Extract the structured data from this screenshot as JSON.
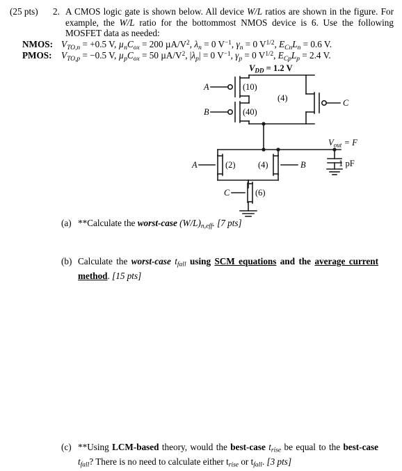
{
  "header": {
    "points": "(25 pts)",
    "number": "2.",
    "line1_a": "A CMOS logic gate is shown below.  All device ",
    "line1_wl": "W/L",
    "line1_b": " ratios are shown in the figure.  For example, the ",
    "line1_wl2": "W/L",
    "line1_c": " ratio for the bottommost NMOS device is 6.  Use the following MOSFET data as needed:"
  },
  "device_data": {
    "nmos_label": "NMOS:",
    "nmos_vto_sym": "V",
    "nmos_vto_sub": "TO,n",
    "nmos_vto_val": "= +0.5 V,",
    "nmos_mu_sym": "µ",
    "nmos_mu_sub": "n",
    "nmos_cox_sym": "C",
    "nmos_cox_sub": "ox",
    "nmos_mu_val": "= 200 µA/V",
    "nmos_mu_exp": "2",
    "nmos_lambda_sym": "λ",
    "nmos_lambda_sub": "n",
    "nmos_lambda_val": "= 0 V",
    "nmos_lambda_exp": "−1",
    "nmos_gamma_sym": "γ",
    "nmos_gamma_sub": "n",
    "nmos_gamma_val": "= 0 V",
    "nmos_gamma_exp": "1/2",
    "nmos_ec_sym": "E",
    "nmos_ec_sub": "Cn",
    "nmos_l_sym": "L",
    "nmos_l_sub": "n",
    "nmos_ec_val": "= 0.6 V.",
    "pmos_label": "PMOS:",
    "pmos_vto_sym": "V",
    "pmos_vto_sub": "TO,p",
    "pmos_vto_val": "= −0.5 V,",
    "pmos_mu_sym": "µ",
    "pmos_mu_sub": "p",
    "pmos_cox_sym": "C",
    "pmos_cox_sub": "ox",
    "pmos_mu_val": "= 50 µA/V",
    "pmos_mu_exp": "2",
    "pmos_lambda_open": "|",
    "pmos_lambda_sym": "λ",
    "pmos_lambda_sub": "p",
    "pmos_lambda_close": "|",
    "pmos_lambda_val": "= 0 V",
    "pmos_lambda_exp": "−1",
    "pmos_gamma_sym": "γ",
    "pmos_gamma_sub": "p",
    "pmos_gamma_val": "= 0 V",
    "pmos_gamma_exp": "1/2",
    "pmos_ec_sym": "E",
    "pmos_ec_sub": "Cp",
    "pmos_l_sym": "L",
    "pmos_l_sub": "p",
    "pmos_ec_val": "= 2.4 V."
  },
  "circuit": {
    "vdd_sym": "V",
    "vdd_sub": "DD",
    "vdd_val": "= 1.2 V",
    "vout_sym": "V",
    "vout_sub": "out",
    "vout_val": "= F",
    "cap_value": "1 pF",
    "pmos": [
      {
        "name": "pmos-a",
        "input": "A",
        "wl": "(10)"
      },
      {
        "name": "pmos-b",
        "input": "B",
        "wl": "(40)"
      },
      {
        "name": "pmos-c",
        "input": "C",
        "wl": "(4)"
      }
    ],
    "nmos": [
      {
        "name": "nmos-a",
        "input": "A",
        "wl": "(2)"
      },
      {
        "name": "nmos-b",
        "input": "B",
        "wl": "(4)"
      },
      {
        "name": "nmos-c",
        "input": "C",
        "wl": "(6)"
      }
    ],
    "line_color": "#1a1a1a"
  },
  "parts": {
    "a": {
      "tag": "(a)",
      "stars": "**",
      "t1": "Calculate the ",
      "worst_case": "worst-case",
      "t2": " (W/L)",
      "sub": "n,eff",
      "t3": ". ",
      "pts": "[7 pts]"
    },
    "b": {
      "tag": "(b)",
      "t1": "Calculate the ",
      "worst_case": "worst-case",
      "t2": " t",
      "sub": "fall",
      "t3": " using ",
      "scm": "SCM equations",
      "t4": " and the ",
      "avg": "average current method",
      "t5": ". ",
      "pts": "[15 pts]"
    },
    "c": {
      "tag": "(c)",
      "stars": "**",
      "t1": "Using ",
      "lcm": "LCM-based",
      "t2": " theory, would the ",
      "best_case": "best-case",
      "t3": " t",
      "sub1": "rise",
      "t4": " be equal to the ",
      "best_case2": "best-case",
      "t5": " t",
      "sub2": "fall",
      "t6": "?  There is no need to calculate either t",
      "sub3": "rise",
      "t7": " or t",
      "sub4": "fall",
      "t8": ". ",
      "pts": "[3 pts]"
    }
  }
}
